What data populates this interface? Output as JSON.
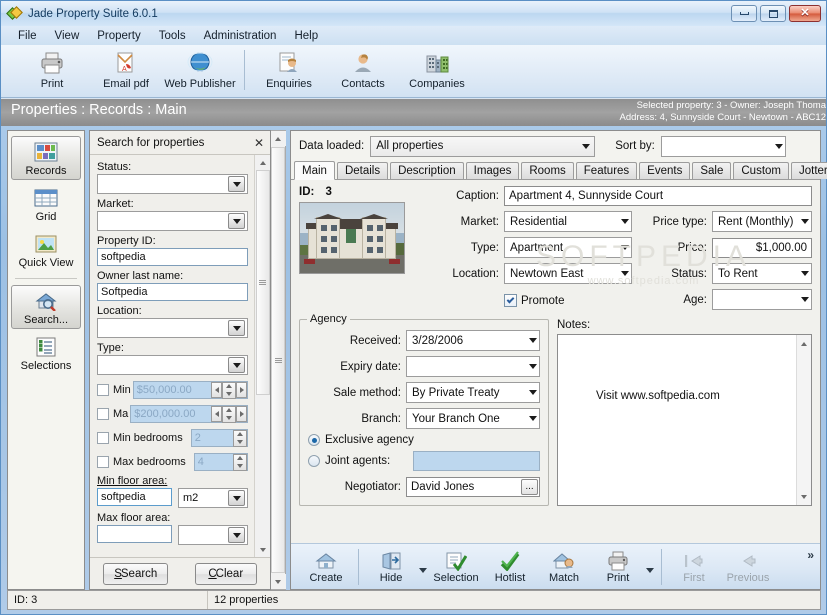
{
  "window": {
    "title": "Jade Property Suite 6.0.1",
    "app_icon": "jade-diamond-icon",
    "minimize": "minimize-icon",
    "maximize": "maximize-icon",
    "close": "close-icon"
  },
  "menu": {
    "items": [
      "File",
      "View",
      "Property",
      "Tools",
      "Administration",
      "Help"
    ]
  },
  "toolbar": {
    "buttons": [
      {
        "label": "Print",
        "icon": "printer-icon"
      },
      {
        "label": "Email pdf",
        "icon": "pdf-email-icon"
      },
      {
        "label": "Web Publisher",
        "icon": "globe-icon"
      },
      {
        "label": "Enquiries",
        "icon": "enquiry-person-icon"
      },
      {
        "label": "Contacts",
        "icon": "contact-person-icon"
      },
      {
        "label": "Companies",
        "icon": "buildings-icon"
      }
    ]
  },
  "page_header": {
    "breadcrumb": "Properties : Records : Main",
    "selected_property": "Selected property: 3 - Owner: Joseph Thoma",
    "address": "Address: 4, Sunnyside Court - Newtown - ABC12"
  },
  "rail": {
    "items": [
      {
        "label": "Records",
        "icon": "records-grid-icon",
        "active": true
      },
      {
        "label": "Grid",
        "icon": "table-grid-icon",
        "active": false
      },
      {
        "label": "Quick View",
        "icon": "picture-icon",
        "active": false
      },
      {
        "label": "Search...",
        "icon": "house-magnifier-icon",
        "active": true
      },
      {
        "label": "Selections",
        "icon": "checklist-icon",
        "active": false
      }
    ]
  },
  "search_panel": {
    "title": "Search for properties",
    "close_icon": "close-icon",
    "fields": [
      {
        "label": "Status:",
        "type": "combo",
        "value": ""
      },
      {
        "label": "Market:",
        "type": "combo",
        "value": ""
      },
      {
        "label": "Property ID:",
        "type": "text",
        "value": "softpedia"
      },
      {
        "label": "Owner last name:",
        "type": "text",
        "value": "Softpedia"
      },
      {
        "label": "Location:",
        "type": "combo",
        "value": ""
      },
      {
        "label": "Type:",
        "type": "combo",
        "value": ""
      }
    ],
    "min_price": {
      "label": "Min",
      "value": "$50,000.00",
      "checked": false
    },
    "max_price": {
      "label": "Ma",
      "value": "$200,000.00",
      "checked": false
    },
    "min_bedrooms": {
      "label": "Min bedrooms",
      "value": "2",
      "checked": false
    },
    "max_bedrooms": {
      "label": "Max bedrooms",
      "value": "4",
      "checked": false
    },
    "min_floor_area": {
      "label": "Min floor area:",
      "value": "softpedia",
      "unit": "m2"
    },
    "max_floor_area": {
      "label": "Max floor area:",
      "value": "",
      "unit": ""
    },
    "search_button": "Search",
    "clear_button": "Clear"
  },
  "main": {
    "data_loaded_label": "Data loaded:",
    "data_loaded_value": "All properties",
    "sort_by_label": "Sort by:",
    "sort_by_value": "",
    "tabs": [
      {
        "label": "Main",
        "active": true
      },
      {
        "label": "Details",
        "active": false
      },
      {
        "label": "Description",
        "active": false
      },
      {
        "label": "Images",
        "active": false
      },
      {
        "label": "Rooms",
        "active": false
      },
      {
        "label": "Features",
        "active": false
      },
      {
        "label": "Events",
        "active": false
      },
      {
        "label": "Sale",
        "active": false
      },
      {
        "label": "Custom",
        "active": false
      },
      {
        "label": "Jotter",
        "active": false
      }
    ],
    "watermark": "SOFTPEDIA",
    "watermark_url": "www.softpedia.com",
    "id_label": "ID:",
    "id_value": "3",
    "photo_icon": "property-photo",
    "caption_label": "Caption:",
    "caption_value": "Apartment 4, Sunnyside Court",
    "market_label": "Market:",
    "market_value": "Residential",
    "type_label": "Type:",
    "type_value": "Apartment",
    "location_label": "Location:",
    "location_value": "Newtown East",
    "promote_label": "Promote",
    "promote_checked": true,
    "price_type_label": "Price type:",
    "price_type_value": "Rent (Monthly)",
    "price_label": "Price:",
    "price_value": "$1,000.00",
    "status_label": "Status:",
    "status_value": "To Rent",
    "age_label": "Age:",
    "age_value": "",
    "agency": {
      "caption": "Agency",
      "received_label": "Received:",
      "received_value": "3/28/2006",
      "expiry_label": "Expiry date:",
      "expiry_value": "",
      "sale_method_label": "Sale method:",
      "sale_method_value": "By Private Treaty",
      "branch_label": "Branch:",
      "branch_value": "Your Branch One",
      "exclusive_label": "Exclusive agency",
      "exclusive_selected": true,
      "joint_label": "Joint agents:",
      "joint_value": "",
      "joint_selected": false,
      "negotiator_label": "Negotiator:",
      "negotiator_value": "David Jones",
      "negotiator_browse": "..."
    },
    "notes_label": "Notes:",
    "notes_value": "Visit www.softpedia.com"
  },
  "command_bar": {
    "buttons": [
      {
        "label": "Create",
        "icon": "house-create-icon",
        "disabled": false,
        "dropdown": false
      },
      {
        "label": "Hide",
        "icon": "hide-door-icon",
        "disabled": false,
        "dropdown": true
      },
      {
        "label": "Selection",
        "icon": "selection-check-icon",
        "disabled": false,
        "dropdown": false
      },
      {
        "label": "Hotlist",
        "icon": "hotlist-check-icon",
        "disabled": false,
        "dropdown": false
      },
      {
        "label": "Match",
        "icon": "house-match-icon",
        "disabled": false,
        "dropdown": false
      },
      {
        "label": "Print",
        "icon": "printer-icon",
        "disabled": false,
        "dropdown": true
      },
      {
        "label": "First",
        "icon": "first-arrow-icon",
        "disabled": true,
        "dropdown": false
      },
      {
        "label": "Previous",
        "icon": "previous-arrow-icon",
        "disabled": true,
        "dropdown": false
      }
    ],
    "overflow": "»"
  },
  "status_bar": {
    "id_text": "ID: 3",
    "count_text": "12 properties"
  },
  "colors": {
    "window_frame": "#9cc0e4",
    "header_gray": "#9a9a9a",
    "accent_blue": "#1c68a8",
    "panel_bg": "#f0efeb",
    "spin_blue": "#bdd7ee"
  }
}
